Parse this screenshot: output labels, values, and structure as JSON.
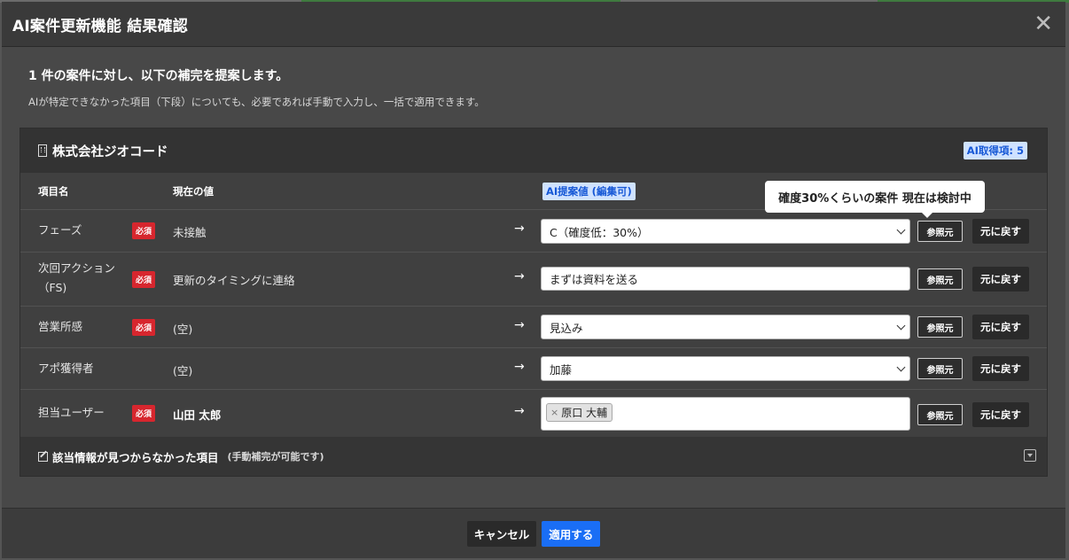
{
  "modal": {
    "title": "AI案件更新機能 結果確認",
    "close_label": "✕",
    "intro_title": "1 件の案件に対し、以下の補完を提案します。",
    "intro_sub": "AIが特定できなかった項目（下段）についても、必要であれば手動で入力し、一括で適用できます。"
  },
  "panel": {
    "company_name": "株式会社ジオコード",
    "ai_count_badge": "AI取得項: 5",
    "columns": {
      "item": "項目名",
      "current": "現在の値",
      "ai": "AI提案値 (編集可)"
    },
    "tooltip": "確度30%くらいの案件 現在は検討中",
    "rows": [
      {
        "label": "フェーズ",
        "required": "必須",
        "current": "未接触",
        "arrow": "→",
        "value": "C（確度低：30%）",
        "ref": "参照元",
        "revert": "元に戻す"
      },
      {
        "label": "次回アクション（FS)",
        "required": "必須",
        "current": "更新のタイミングに連絡",
        "arrow": "→",
        "value": "まずは資料を送る",
        "ref": "参照元",
        "revert": "元に戻す"
      },
      {
        "label": "営業所感",
        "required": "必須",
        "current": "(空)",
        "arrow": "→",
        "value": "見込み",
        "ref": "参照元",
        "revert": "元に戻す"
      },
      {
        "label": "アポ獲得者",
        "required": "",
        "current": "(空)",
        "arrow": "→",
        "value": "加藤",
        "ref": "参照元",
        "revert": "元に戻す"
      },
      {
        "label": "担当ユーザー",
        "required": "必須",
        "current": "山田 太郎",
        "arrow": "→",
        "tag_remove": "×",
        "tag": "原口 大輔",
        "ref": "参照元",
        "revert": "元に戻す"
      }
    ],
    "footer_title": "該当情報が見つからなかった項目",
    "footer_note": "(手動補完が可能です)"
  },
  "footer": {
    "cancel": "キャンセル",
    "apply": "適用する"
  }
}
